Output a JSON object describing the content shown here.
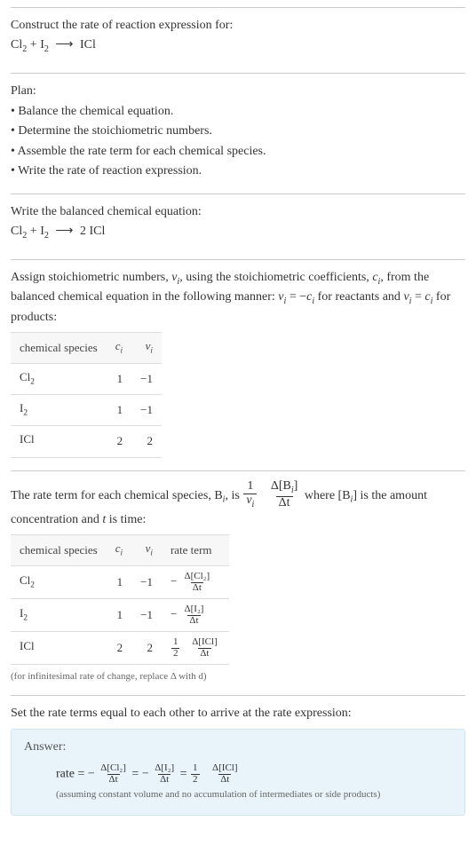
{
  "prompt": {
    "intro": "Construct the rate of reaction expression for:",
    "eq_parts": {
      "cl2": "Cl",
      "plus": " + ",
      "i2": "I",
      "arrow": "⟶",
      "icl": " ICl"
    }
  },
  "plan": {
    "heading": "Plan:",
    "items": [
      "• Balance the chemical equation.",
      "• Determine the stoichiometric numbers.",
      "• Assemble the rate term for each chemical species.",
      "• Write the rate of reaction expression."
    ]
  },
  "balanced": {
    "intro": "Write the balanced chemical equation:",
    "eq_parts": {
      "cl2": "Cl",
      "plus": " + ",
      "i2": "I",
      "arrow": "⟶",
      "icl": " 2 ICl"
    }
  },
  "assign": {
    "text_a": "Assign stoichiometric numbers, ",
    "nu_i": "ν",
    "text_b": ", using the stoichiometric coefficients, ",
    "c_i": "c",
    "text_c": ", from the balanced chemical equation in the following manner: ",
    "eq1_lhs": "ν",
    "eq1_mid": " = −",
    "eq1_rhs": "c",
    "text_d": " for reactants and ",
    "eq2_lhs": "ν",
    "eq2_mid": " = ",
    "eq2_rhs": "c",
    "text_e": " for products:",
    "table": {
      "headers": {
        "species": "chemical species",
        "c": "c",
        "nu": "ν"
      },
      "rows": [
        {
          "species": "Cl",
          "sub": "2",
          "c": "1",
          "nu": "−1"
        },
        {
          "species": "I",
          "sub": "2",
          "c": "1",
          "nu": "−1"
        },
        {
          "species": "ICl",
          "sub": "",
          "c": "2",
          "nu": "2"
        }
      ]
    }
  },
  "rateterm": {
    "prefix": "The rate term for each chemical species, B",
    "mid1": ", is ",
    "frac1_num": "1",
    "frac1_den": "ν",
    "frac2_num": "Δ[B",
    "frac2_num_suffix": "]",
    "frac2_den": "Δt",
    "mid2": " where [B",
    "mid3": "] is the amount concentration and ",
    "t": "t",
    "mid4": " is time:",
    "table": {
      "headers": {
        "species": "chemical species",
        "c": "c",
        "nu": "ν",
        "rate": "rate term"
      },
      "rows": [
        {
          "species": "Cl",
          "sub": "2",
          "c": "1",
          "nu": "−1",
          "neg": "−",
          "coef_num": "",
          "coef_den": "",
          "d_num": "Δ[Cl₂]",
          "d_den": "Δt"
        },
        {
          "species": "I",
          "sub": "2",
          "c": "1",
          "nu": "−1",
          "neg": "−",
          "coef_num": "",
          "coef_den": "",
          "d_num": "Δ[I₂]",
          "d_den": "Δt"
        },
        {
          "species": "ICl",
          "sub": "",
          "c": "2",
          "nu": "2",
          "neg": "",
          "coef_num": "1",
          "coef_den": "2",
          "d_num": "Δ[ICl]",
          "d_den": "Δt"
        }
      ]
    },
    "note": "(for infinitesimal rate of change, replace Δ with d)"
  },
  "setequal": {
    "text": "Set the rate terms equal to each other to arrive at the rate expression:"
  },
  "answer": {
    "label": "Answer:",
    "rate": "rate = ",
    "t1_neg": "− ",
    "t1_num": "Δ[Cl₂]",
    "t1_den": "Δt",
    "eq": " = ",
    "t2_neg": "− ",
    "t2_num": "Δ[I₂]",
    "t2_den": "Δt",
    "t3_coef_num": "1",
    "t3_coef_den": "2",
    "t3_num": "Δ[ICl]",
    "t3_den": "Δt",
    "assumption": "(assuming constant volume and no accumulation of intermediates or side products)"
  },
  "chart_data": {
    "type": "table",
    "title": "Stoichiometric numbers and rate terms for Cl2 + I2 → 2 ICl",
    "columns": [
      "chemical species",
      "c_i",
      "nu_i",
      "rate term"
    ],
    "rows": [
      [
        "Cl2",
        1,
        -1,
        "-(Δ[Cl2]/Δt)"
      ],
      [
        "I2",
        1,
        -1,
        "-(Δ[I2]/Δt)"
      ],
      [
        "ICl",
        2,
        2,
        "(1/2)(Δ[ICl]/Δt)"
      ]
    ],
    "rate_expression": "rate = -(Δ[Cl2]/Δt) = -(Δ[I2]/Δt) = (1/2)(Δ[ICl]/Δt)"
  }
}
